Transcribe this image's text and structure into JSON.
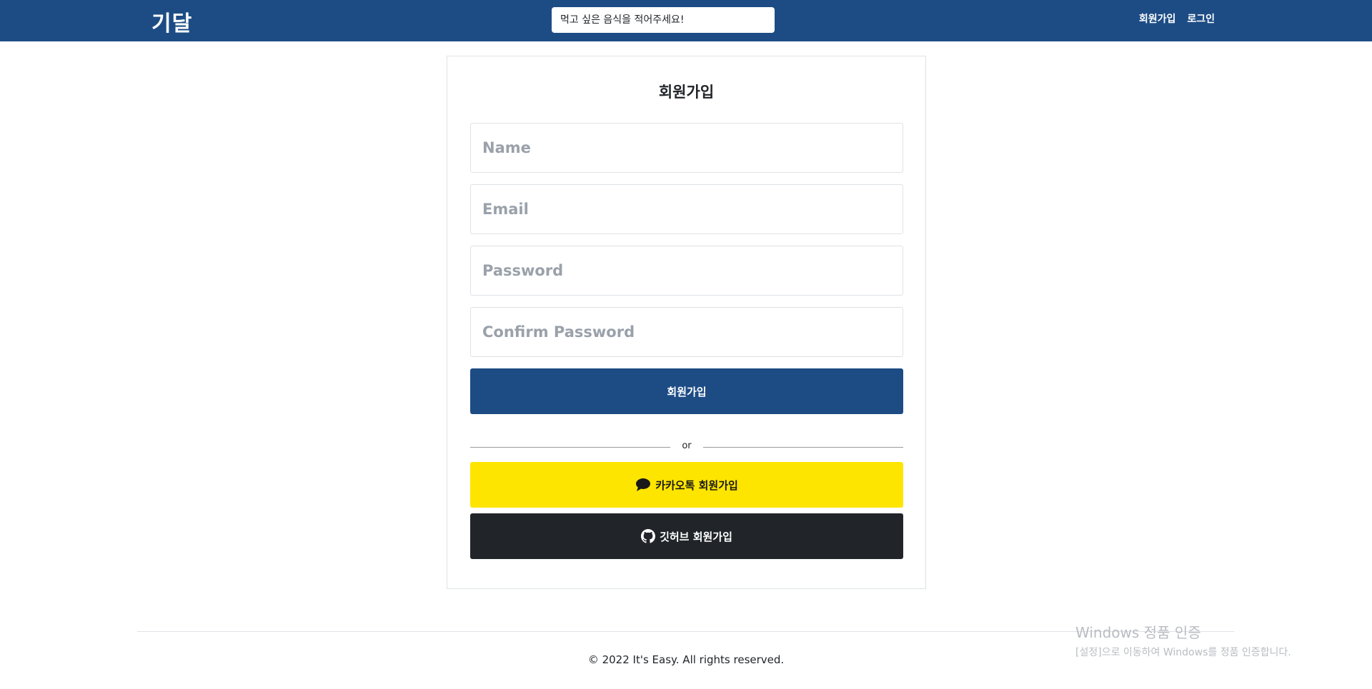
{
  "header": {
    "brand": "기달",
    "search_placeholder": "먹고 싶은 음식을 적어주세요!",
    "nav": [
      "회원가입",
      "로그인"
    ]
  },
  "signup": {
    "title": "회원가입",
    "fields": {
      "name_placeholder": "Name",
      "email_placeholder": "Email",
      "password_placeholder": "Password",
      "confirm_placeholder": "Confirm Password"
    },
    "submit_label": "회원가입",
    "divider_text": "or",
    "kakao_label": "카카오톡 회원가입",
    "github_label": "깃허브 회원가입"
  },
  "footer": {
    "copyright": "© 2022 It's Easy. All rights reserved."
  },
  "watermark": {
    "title": "Windows 정품 인증",
    "subtitle": "[설정]으로 이동하여 Windows를 정품 인증합니다."
  },
  "colors": {
    "brand_navy": "#1d4c85",
    "kakao_yellow": "#fee500",
    "github_dark": "#212529"
  },
  "icons": [
    "chat-bubble-icon",
    "github-icon"
  ]
}
